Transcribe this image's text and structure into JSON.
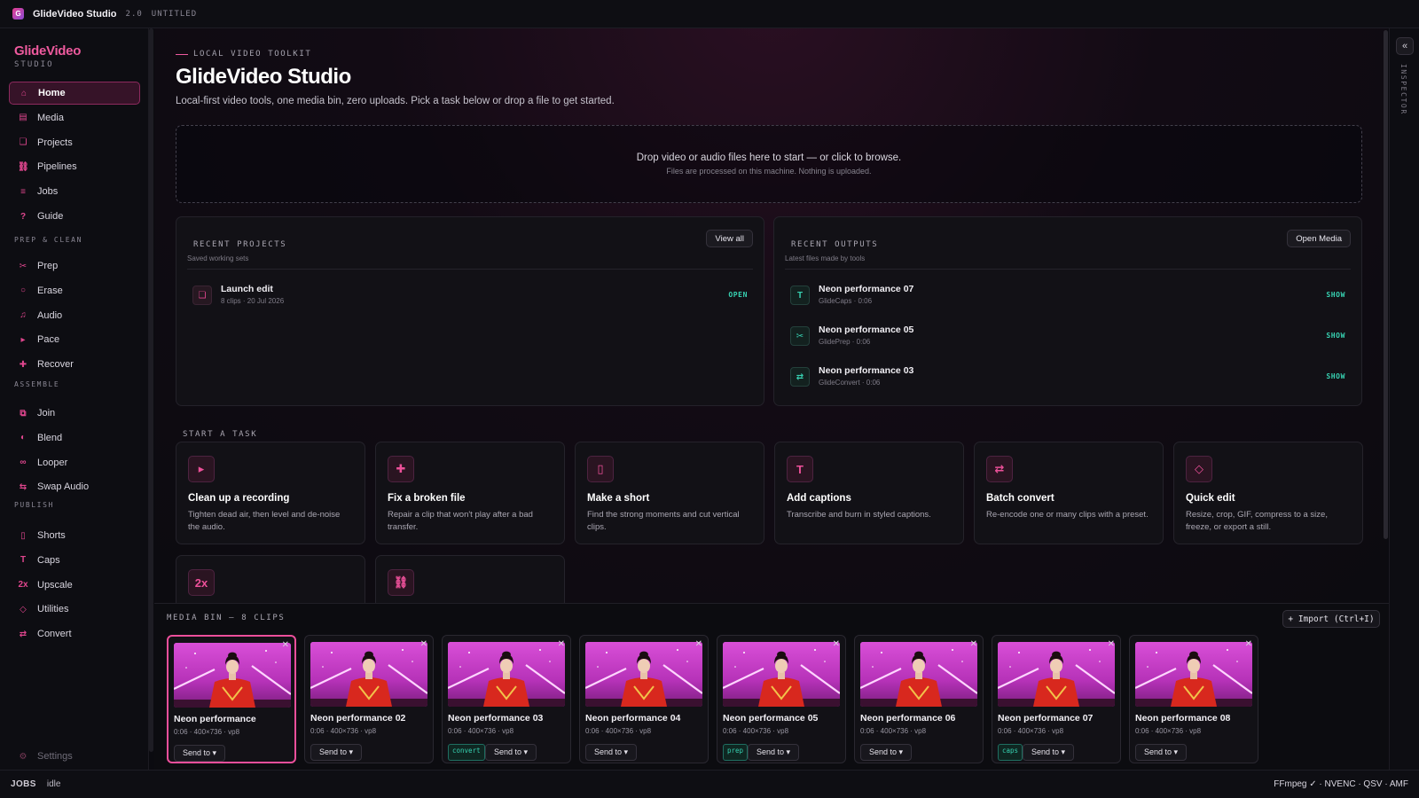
{
  "titlebar": {
    "app_title": "GlideVideo Studio",
    "version": "2.0",
    "document": "UNTITLED"
  },
  "brand": {
    "name": "GlideVideo",
    "sub": "STUDIO"
  },
  "sidebar": {
    "items": [
      {
        "label": "Home",
        "icon": "home-icon",
        "glyph": "⌂",
        "active": true
      },
      {
        "label": "Media",
        "icon": "media-icon",
        "glyph": "▤"
      },
      {
        "label": "Projects",
        "icon": "projects-icon",
        "glyph": "❏"
      },
      {
        "label": "Pipelines",
        "icon": "pipelines-icon",
        "glyph": "⛓"
      },
      {
        "label": "Jobs",
        "icon": "jobs-icon",
        "glyph": "≡"
      },
      {
        "label": "Guide",
        "icon": "guide-icon",
        "glyph": "?"
      }
    ],
    "sections": {
      "prep": "PREP & CLEAN",
      "assemble": "ASSEMBLE",
      "publish": "PUBLISH"
    },
    "prep_items": [
      {
        "label": "Prep",
        "icon": "scissors-icon",
        "glyph": "✂"
      },
      {
        "label": "Erase",
        "icon": "erase-icon",
        "glyph": "○"
      },
      {
        "label": "Audio",
        "icon": "audio-icon",
        "glyph": "♫"
      },
      {
        "label": "Pace",
        "icon": "pace-icon",
        "glyph": "▸"
      },
      {
        "label": "Recover",
        "icon": "recover-icon",
        "glyph": "✚"
      }
    ],
    "assemble_items": [
      {
        "label": "Join",
        "icon": "join-icon",
        "glyph": "⧉"
      },
      {
        "label": "Blend",
        "icon": "blend-icon",
        "glyph": "◐"
      },
      {
        "label": "Looper",
        "icon": "loop-icon",
        "glyph": "∞"
      },
      {
        "label": "Swap Audio",
        "icon": "swap-audio-icon",
        "glyph": "⇆"
      }
    ],
    "publish_items": [
      {
        "label": "Shorts",
        "icon": "shorts-icon",
        "glyph": "▯"
      },
      {
        "label": "Caps",
        "icon": "caps-icon",
        "glyph": "T"
      },
      {
        "label": "Upscale",
        "icon": "upscale-icon",
        "glyph": "2x"
      },
      {
        "label": "Utilities",
        "icon": "utilities-icon",
        "glyph": "◇"
      },
      {
        "label": "Convert",
        "icon": "convert-icon",
        "glyph": "⇄"
      }
    ],
    "settings": {
      "label": "Settings",
      "icon": "settings-icon",
      "glyph": "⚙"
    }
  },
  "main": {
    "eyebrow": "LOCAL VIDEO TOOLKIT",
    "title": "GlideVideo Studio",
    "subtitle": "Local-first video tools, one media bin, zero uploads. Pick a task below or drop a file to get started.",
    "dropzone": {
      "main": "Drop video or audio files here to start — or click to browse.",
      "sub": "Files are processed on this machine. Nothing is uploaded."
    }
  },
  "recent_projects": {
    "title": "RECENT PROJECTS",
    "sub": "Saved working sets",
    "button": "View all",
    "items": [
      {
        "title": "Launch edit",
        "meta": "8 clips · 20 Jul 2026",
        "action": "OPEN",
        "icon": "project-icon",
        "glyph": "❏"
      }
    ]
  },
  "recent_outputs": {
    "title": "RECENT OUTPUTS",
    "sub": "Latest files made by tools",
    "button": "Open Media",
    "items": [
      {
        "title": "Neon performance 07",
        "meta": "GlideCaps · 0:06",
        "action": "SHOW",
        "icon": "caps-icon",
        "glyph": "T"
      },
      {
        "title": "Neon performance 05",
        "meta": "GlidePrep · 0:06",
        "action": "SHOW",
        "icon": "scissors-icon",
        "glyph": "✂"
      },
      {
        "title": "Neon performance 03",
        "meta": "GlideConvert · 0:06",
        "action": "SHOW",
        "icon": "convert-icon",
        "glyph": "⇄"
      }
    ]
  },
  "tasks": {
    "heading": "START A TASK",
    "items": [
      {
        "title": "Clean up a recording",
        "desc": "Tighten dead air, then level and de-noise the audio.",
        "icon": "play-icon",
        "glyph": "▸"
      },
      {
        "title": "Fix a broken file",
        "desc": "Repair a clip that won't play after a bad transfer.",
        "icon": "repair-icon",
        "glyph": "✚"
      },
      {
        "title": "Make a short",
        "desc": "Find the strong moments and cut vertical clips.",
        "icon": "shorts-icon",
        "glyph": "▯"
      },
      {
        "title": "Add captions",
        "desc": "Transcribe and burn in styled captions.",
        "icon": "caps-icon",
        "glyph": "T"
      },
      {
        "title": "Batch convert",
        "desc": "Re-encode one or many clips with a preset.",
        "icon": "convert-icon",
        "glyph": "⇄"
      },
      {
        "title": "Quick edit",
        "desc": "Resize, crop, GIF, compress to a size, freeze, or export a still.",
        "icon": "utilities-icon",
        "glyph": "◇"
      }
    ],
    "partial": [
      {
        "icon": "upscale-icon",
        "glyph": "2x"
      },
      {
        "icon": "pipelines-icon",
        "glyph": "⛓"
      }
    ]
  },
  "inspector": {
    "toggle": "«",
    "label": "INSPECTOR"
  },
  "media_bin": {
    "heading": "MEDIA BIN — 8 CLIPS",
    "import": "+ Import (Ctrl+I)",
    "send_label": "Send to ▾",
    "clips": [
      {
        "title": "Neon performance",
        "meta": "0:06 · 400×736 · vp8",
        "tag": "",
        "selected": true
      },
      {
        "title": "Neon performance 02",
        "meta": "0:06 · 400×736 · vp8",
        "tag": ""
      },
      {
        "title": "Neon performance 03",
        "meta": "0:06 · 400×736 · vp8",
        "tag": "convert"
      },
      {
        "title": "Neon performance 04",
        "meta": "0:06 · 400×736 · vp8",
        "tag": ""
      },
      {
        "title": "Neon performance 05",
        "meta": "0:06 · 400×736 · vp8",
        "tag": "prep"
      },
      {
        "title": "Neon performance 06",
        "meta": "0:06 · 400×736 · vp8",
        "tag": ""
      },
      {
        "title": "Neon performance 07",
        "meta": "0:06 · 400×736 · vp8",
        "tag": "caps"
      },
      {
        "title": "Neon performance 08",
        "meta": "0:06 · 400×736 · vp8",
        "tag": ""
      }
    ]
  },
  "status": {
    "jobs_label": "JOBS",
    "jobs_state": "idle",
    "engines": "FFmpeg ✓ · NVENC · QSV · AMF"
  },
  "colors": {
    "accent": "#ec4f9b",
    "teal": "#37d1b1",
    "background": "#0b0b10"
  }
}
